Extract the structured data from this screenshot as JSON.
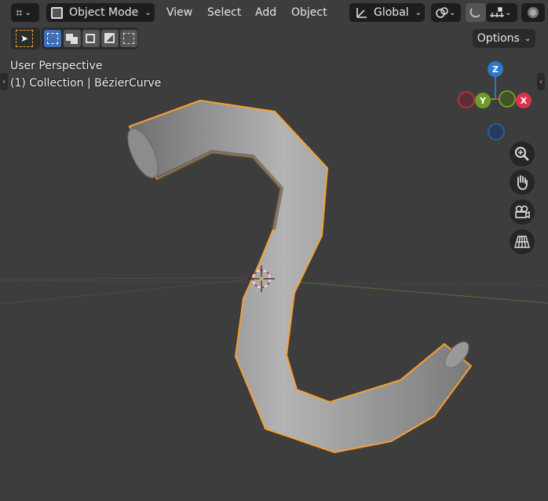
{
  "header": {
    "mode_label": "Object Mode",
    "menus": [
      "View",
      "Select",
      "Add",
      "Object"
    ],
    "orientation_label": "Global",
    "options_label": "Options"
  },
  "overlay": {
    "view_name": "User Perspective",
    "collection_info": "(1) Collection | BézierCurve"
  },
  "gizmo": {
    "z_label": "Z",
    "y_label": "Y",
    "x_label": "X",
    "colors": {
      "x": "#d9344d",
      "y": "#6d9d26",
      "z": "#2d78c8",
      "selection": "#f5a030"
    }
  },
  "icons": [
    "tool-icon",
    "editor-type-icon",
    "object-mode-icon",
    "transform-orientation-icon",
    "snap-icon",
    "proportional-edit-icon",
    "overlay-icon",
    "zoom-icon",
    "pan-hand-icon",
    "camera-icon",
    "grid-view-icon",
    "select-cursor-icon"
  ]
}
